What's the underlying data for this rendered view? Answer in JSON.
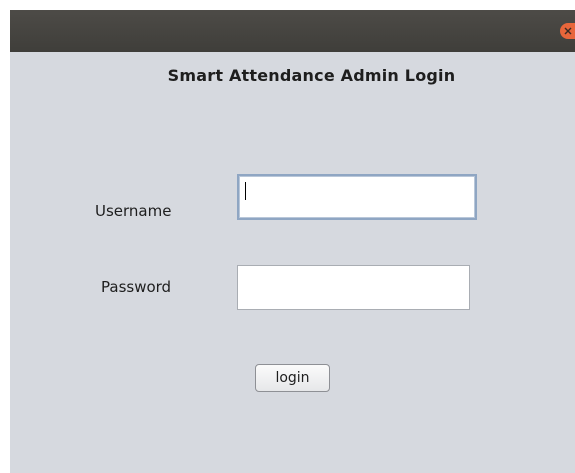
{
  "window": {
    "close_icon": "close-icon"
  },
  "login_form": {
    "heading": "Smart Attendance Admin Login",
    "username_label": "Username",
    "username_value": "",
    "password_label": "Password",
    "password_value": "",
    "login_button": "login"
  },
  "colors": {
    "titlebar": "#43423e",
    "close_button": "#e8663b",
    "panel_background": "#d6d9df",
    "focused_field_border": "#8fa6c3"
  }
}
